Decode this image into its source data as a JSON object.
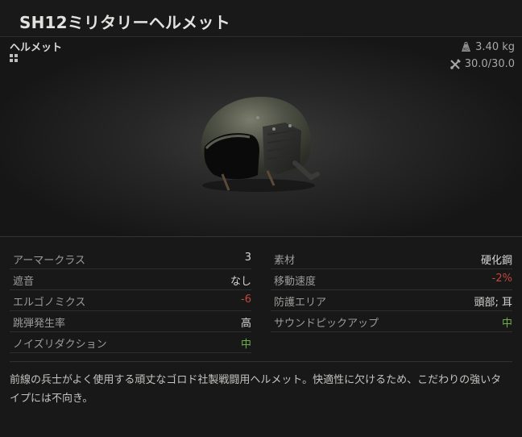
{
  "item": {
    "title": "SH12ミリタリーヘルメット",
    "category": "ヘルメット",
    "weight": "3.40 kg",
    "durability": "30.0/30.0"
  },
  "stats_left": [
    {
      "label": "アーマークラス",
      "value": "3",
      "tone": "normal"
    },
    {
      "label": "遮音",
      "value": "なし",
      "tone": "normal"
    },
    {
      "label": "エルゴノミクス",
      "value": "-6",
      "tone": "negative"
    },
    {
      "label": "跳弾発生率",
      "value": "高",
      "tone": "normal"
    },
    {
      "label": "ノイズリダクション",
      "value": "中",
      "tone": "positive"
    }
  ],
  "stats_right": [
    {
      "label": "素材",
      "value": "硬化鋼",
      "tone": "normal"
    },
    {
      "label": "移動速度",
      "value": "-2%",
      "tone": "negative"
    },
    {
      "label": "防護エリア",
      "value": "頭部; 耳",
      "tone": "normal"
    },
    {
      "label": "サウンドピックアップ",
      "value": "中",
      "tone": "positive"
    }
  ],
  "description": "前線の兵士がよく使用する頑丈なゴロド社製戦闘用ヘルメット。快適性に欠けるため、こだわりの強いタイプには不向き。",
  "icons": {
    "category": "grid-icon",
    "weight": "weight-icon",
    "durability": "wrench-icon"
  },
  "colors": {
    "negative": "#c5463d",
    "positive": "#6fae4b"
  }
}
